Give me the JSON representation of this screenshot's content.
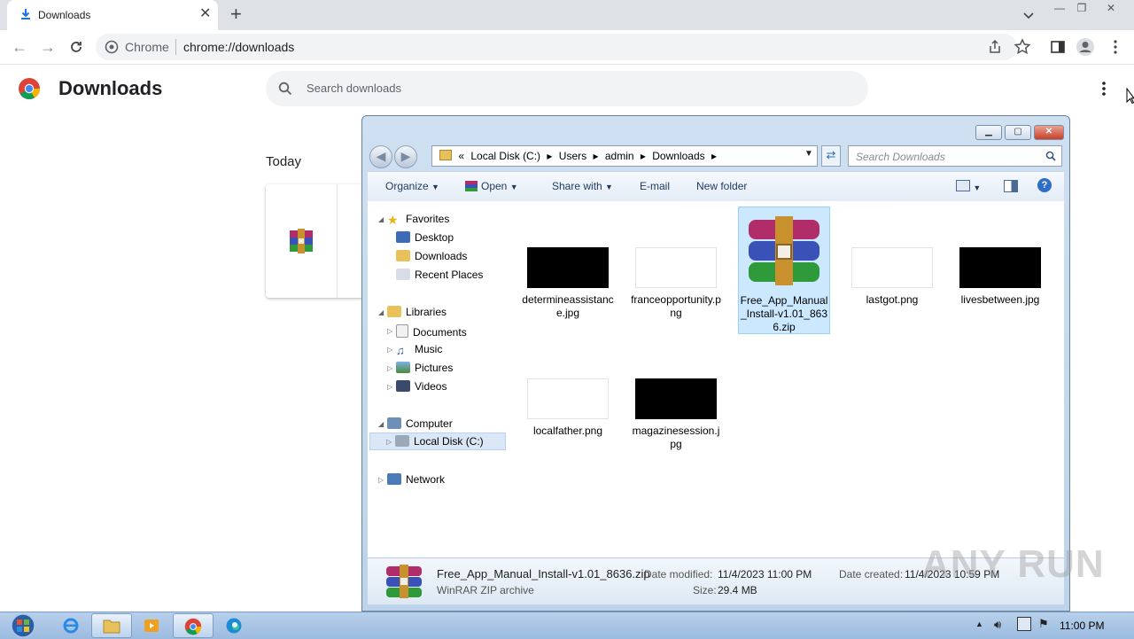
{
  "browser": {
    "tab_title": "Downloads",
    "tab_close": "✕",
    "new_tab": "+",
    "chip": "Chrome",
    "url": "chrome://downloads",
    "window_controls": {
      "minimize": "—",
      "restore": "❐",
      "close": "✕"
    }
  },
  "downloads_page": {
    "title": "Downloads",
    "search_placeholder": "Search downloads",
    "section": "Today"
  },
  "explorer": {
    "breadcrumbs": [
      "«",
      "Local Disk (C:)",
      "▸",
      "Users",
      "▸",
      "admin",
      "▸",
      "Downloads",
      "▸"
    ],
    "search_placeholder": "Search Downloads",
    "commands": [
      "Organize",
      "Open",
      "Share with",
      "E-mail",
      "New folder"
    ],
    "nav": {
      "favorites": "Favorites",
      "desktop": "Desktop",
      "downloads": "Downloads",
      "recent": "Recent Places",
      "libraries": "Libraries",
      "documents": "Documents",
      "music": "Music",
      "pictures": "Pictures",
      "videos": "Videos",
      "computer": "Computer",
      "local_disk": "Local Disk (C:)",
      "network": "Network"
    },
    "files": [
      {
        "name": "determineassistance.jpg",
        "thumb": "#000000"
      },
      {
        "name": "franceopportunity.png",
        "thumb": "#ffffff"
      },
      {
        "name": "Free_App_Manual_Install-v1.01_8636.zip",
        "thumb": "rar"
      },
      {
        "name": "lastgot.png",
        "thumb": "#ffffff"
      },
      {
        "name": "livesbetween.jpg",
        "thumb": "#000000"
      },
      {
        "name": "localfather.png",
        "thumb": "#ffffff"
      },
      {
        "name": "magazinesession.jpg",
        "thumb": "#000000"
      }
    ],
    "details": {
      "filename": "Free_App_Manual_Install-v1.01_8636.zip",
      "type": "WinRAR ZIP archive",
      "modified_label": "Date modified:",
      "modified": "11/4/2023 11:00 PM",
      "created_label": "Date created:",
      "created": "11/4/2023 10:59 PM",
      "size_label": "Size:",
      "size": "29.4 MB"
    }
  },
  "taskbar": {
    "clock": "11:00 PM"
  },
  "watermark": "ANY RUN",
  "colors": {
    "chrome_tab_strip": "#dee1e6",
    "explorer_frame": "#bcd3ea",
    "selection": "#cce8ff",
    "taskbar": "#9bbbe0"
  }
}
